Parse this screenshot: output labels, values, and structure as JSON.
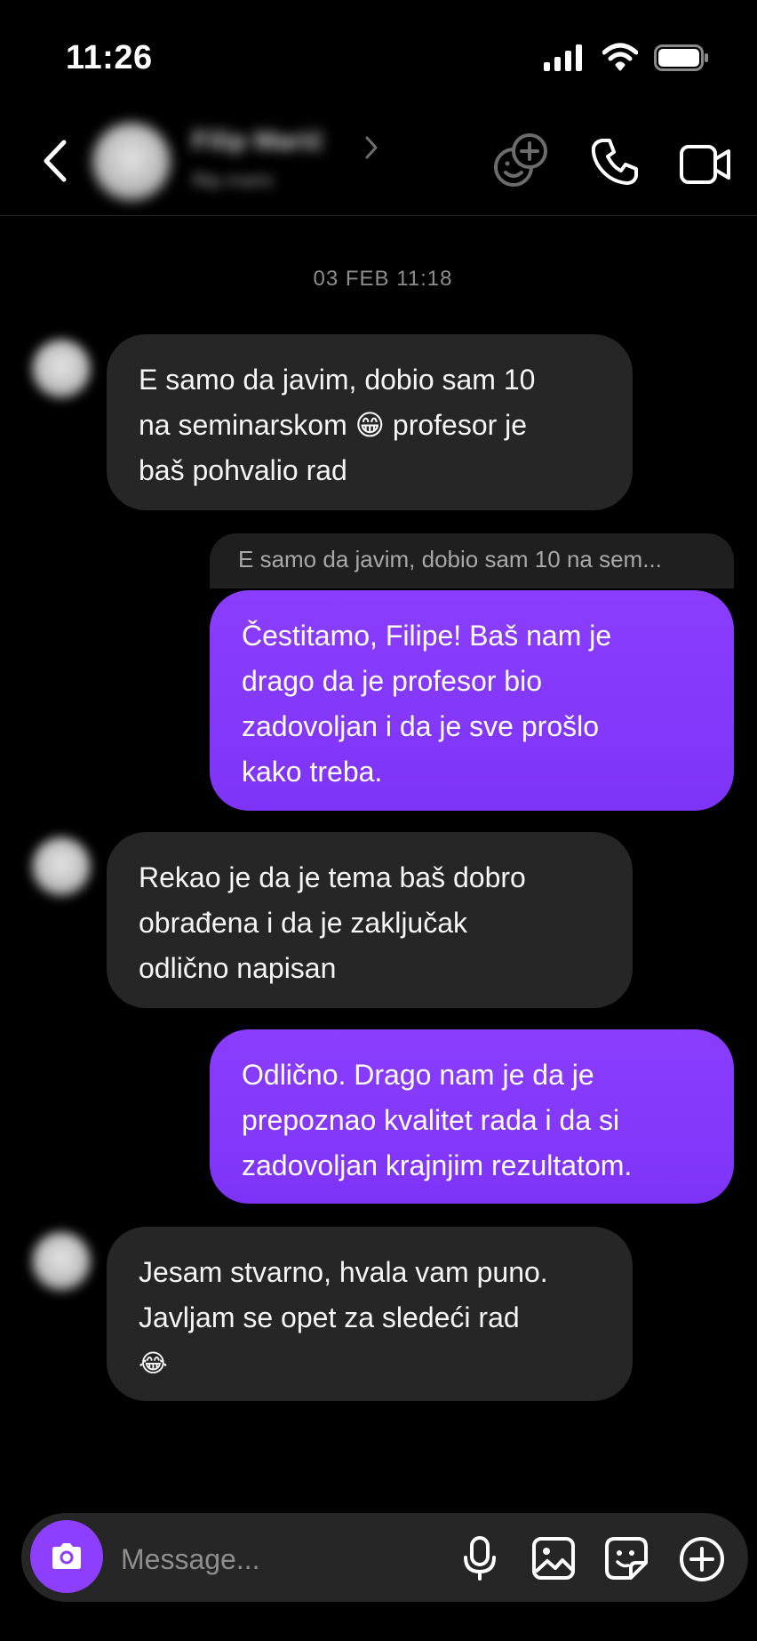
{
  "status_bar": {
    "time": "11:26"
  },
  "header": {
    "contact_name": "Filip Marić",
    "contact_sub": "filip.maric"
  },
  "thread": {
    "timestamp": "03 FEB 11:18",
    "messages": [
      {
        "direction": "incoming",
        "lines": [
          "E samo da javim, dobio sam 10",
          "na seminarskom 😁  profesor je",
          "baš pohvalio rad"
        ]
      },
      {
        "direction": "outgoing",
        "reply_to": "E samo da javim, dobio sam 10 na sem...",
        "lines": [
          "Čestitamo, Filipe! Baš nam je",
          "drago da je profesor bio",
          "zadovoljan i da je sve prošlo",
          "kako treba."
        ]
      },
      {
        "direction": "incoming",
        "lines": [
          "Rekao je da je tema baš dobro",
          "obrađena i da je zaključak",
          "odlično napisan"
        ]
      },
      {
        "direction": "outgoing",
        "lines": [
          "Odlično. Drago nam je da je",
          "prepoznao kvalitet rada i da si",
          "zadovoljan krajnjim rezultatom."
        ]
      },
      {
        "direction": "incoming",
        "lines": [
          "Jesam stvarno, hvala vam puno.",
          "Javljam se opet za sledeći rad",
          "😂"
        ]
      }
    ]
  },
  "composer": {
    "placeholder": "Message..."
  },
  "colors": {
    "accent": "#8d3ffd",
    "incoming_bubble": "#262626",
    "background": "#000000"
  },
  "icons": [
    "back-chevron-icon",
    "add-people-icon",
    "phone-icon",
    "video-camera-icon",
    "camera-icon",
    "microphone-icon",
    "gallery-icon",
    "sticker-icon",
    "plus-icon"
  ]
}
